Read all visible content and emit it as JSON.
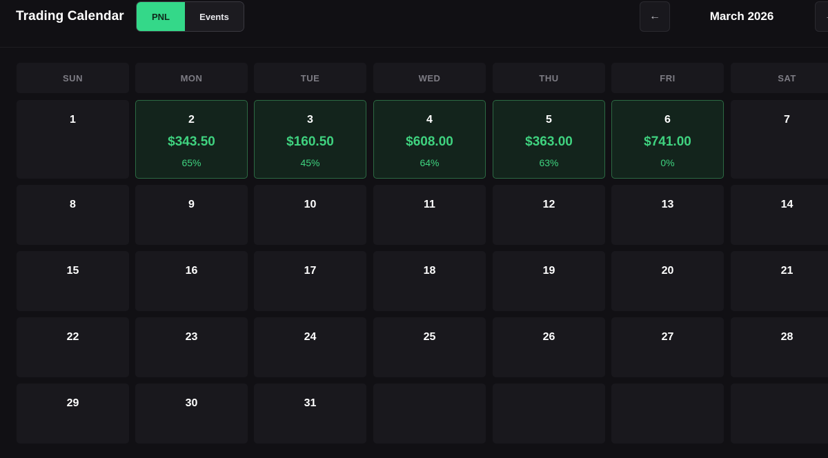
{
  "header": {
    "title": "Trading Calendar",
    "toggle": {
      "pnl_label": "PNL",
      "events_label": "Events",
      "active": "PNL"
    },
    "prev_label": "←",
    "next_label": "→",
    "month_label": "March 2026"
  },
  "colors": {
    "background": "#111014",
    "cell": "#19181d",
    "profit_cell": "#13241c",
    "profit_border": "#2c6a43",
    "accent_green": "#34d889",
    "profit_text": "#3fd27f"
  },
  "weekdays": [
    "SUN",
    "MON",
    "TUE",
    "WED",
    "THU",
    "FRI",
    "SAT"
  ],
  "weeks": [
    [
      {
        "day": "1"
      },
      {
        "day": "2",
        "pnl": "$343.50",
        "pct": "65%"
      },
      {
        "day": "3",
        "pnl": "$160.50",
        "pct": "45%"
      },
      {
        "day": "4",
        "pnl": "$608.00",
        "pct": "64%"
      },
      {
        "day": "5",
        "pnl": "$363.00",
        "pct": "63%"
      },
      {
        "day": "6",
        "pnl": "$741.00",
        "pct": "0%"
      },
      {
        "day": "7"
      }
    ],
    [
      {
        "day": "8"
      },
      {
        "day": "9"
      },
      {
        "day": "10"
      },
      {
        "day": "11"
      },
      {
        "day": "12"
      },
      {
        "day": "13"
      },
      {
        "day": "14"
      }
    ],
    [
      {
        "day": "15"
      },
      {
        "day": "16"
      },
      {
        "day": "17"
      },
      {
        "day": "18"
      },
      {
        "day": "19"
      },
      {
        "day": "20"
      },
      {
        "day": "21"
      }
    ],
    [
      {
        "day": "22"
      },
      {
        "day": "23"
      },
      {
        "day": "24"
      },
      {
        "day": "25"
      },
      {
        "day": "26"
      },
      {
        "day": "27"
      },
      {
        "day": "28"
      }
    ],
    [
      {
        "day": "29"
      },
      {
        "day": "30"
      },
      {
        "day": "31"
      },
      {
        "day": ""
      },
      {
        "day": ""
      },
      {
        "day": ""
      },
      {
        "day": ""
      }
    ]
  ]
}
